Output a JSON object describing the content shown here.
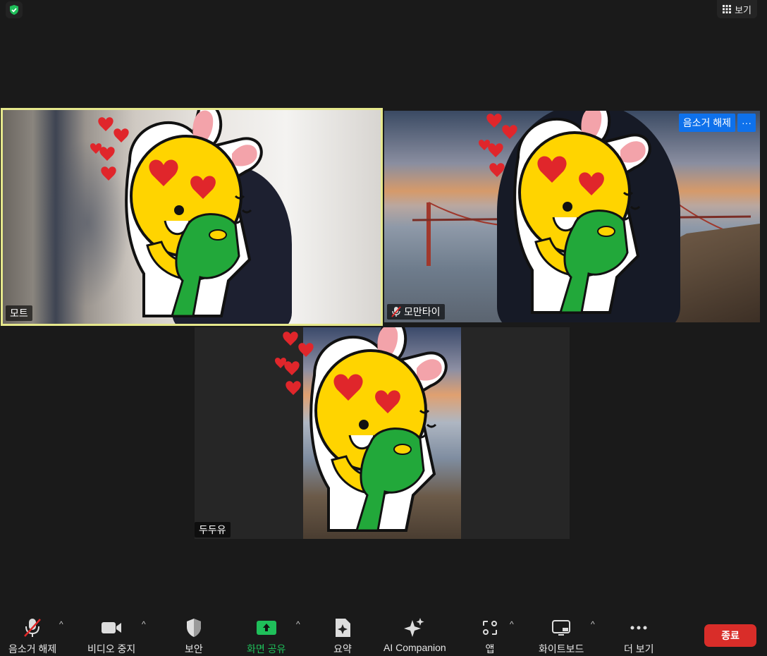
{
  "top": {
    "view_label": "보기"
  },
  "tiles": {
    "a": {
      "name": "모트"
    },
    "b": {
      "name": "모만타이",
      "unmute_label": "음소거 해제",
      "more_label": "···"
    },
    "c": {
      "name": "두두유"
    }
  },
  "toolbar": {
    "unmute": "음소거 해제",
    "video": "비디오 중지",
    "security": "보안",
    "share": "화면 공유",
    "summary": "요약",
    "ai": "AI Companion",
    "apps": "앱",
    "whiteboard": "화이트보드",
    "more": "더 보기",
    "end": "종료"
  },
  "colors": {
    "accent_green": "#1fbf5a",
    "end_red": "#d92d29",
    "active_border": "#e6e88c",
    "blue_button": "#0e71eb"
  }
}
